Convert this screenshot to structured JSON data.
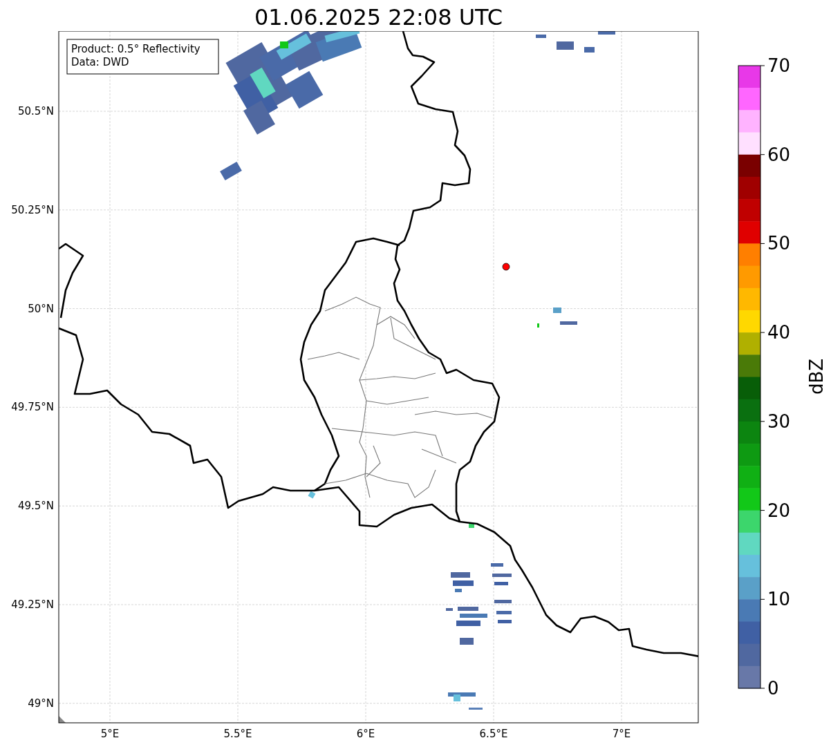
{
  "title": "01.06.2025 22:08 UTC",
  "map": {
    "legend": [
      "Product: 0.5° Reflectivity",
      "Data: DWD"
    ],
    "x_ticks": [
      "5°E",
      "5.5°E",
      "6°E",
      "6.5°E",
      "7°E"
    ],
    "y_ticks": [
      "50.5°N",
      "50.25°N",
      "50°N",
      "49.75°N",
      "49.5°N",
      "49.25°N",
      "49°N"
    ]
  },
  "colorbar": {
    "label": "dBZ",
    "ticks": [
      "70",
      "60",
      "50",
      "40",
      "30",
      "20",
      "10",
      "0"
    ],
    "bins": [
      {
        "color": "#e838e8"
      },
      {
        "color": "#ff66ff"
      },
      {
        "color": "#ffb3ff"
      },
      {
        "color": "#ffe0ff"
      },
      {
        "color": "#7a0000"
      },
      {
        "color": "#a00000"
      },
      {
        "color": "#c00000"
      },
      {
        "color": "#e00000"
      },
      {
        "color": "#ff7f00"
      },
      {
        "color": "#ff9a00"
      },
      {
        "color": "#ffb800"
      },
      {
        "color": "#ffd800"
      },
      {
        "color": "#b0b000"
      },
      {
        "color": "#4a7a08"
      },
      {
        "color": "#085e08"
      },
      {
        "color": "#0a7010"
      },
      {
        "color": "#0c8510"
      },
      {
        "color": "#0e9a12"
      },
      {
        "color": "#10b014"
      },
      {
        "color": "#12c818"
      },
      {
        "color": "#3cd66c"
      },
      {
        "color": "#60d8c0"
      },
      {
        "color": "#66c0dc"
      },
      {
        "color": "#5aa0c8"
      },
      {
        "color": "#4a7ab4"
      },
      {
        "color": "#4060a4"
      },
      {
        "color": "#5068a0"
      },
      {
        "color": "#6878a8"
      }
    ]
  }
}
